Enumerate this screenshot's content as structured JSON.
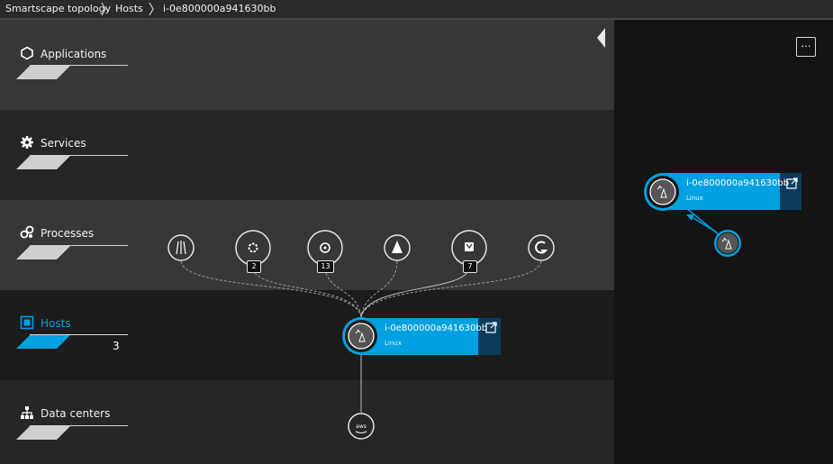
{
  "breadcrumb": {
    "items": [
      "Smartscape topology",
      "Hosts",
      "i-0e800000a941630bb"
    ]
  },
  "layers": [
    {
      "label": "Applications",
      "icon": "hexagon-icon"
    },
    {
      "label": "Services",
      "icon": "gear-icon"
    },
    {
      "label": "Processes",
      "icon": "processes-icon"
    },
    {
      "label": "Hosts",
      "icon": "host-icon",
      "count": "3",
      "active": true
    },
    {
      "label": "Data centers",
      "icon": "datacenter-icon"
    }
  ],
  "processes": [
    {
      "icon": "linux-process-icon",
      "badge": ""
    },
    {
      "icon": "settings-process-icon",
      "badge": "2"
    },
    {
      "icon": "kubernetes-icon",
      "badge": "13"
    },
    {
      "icon": "sail-process-icon",
      "badge": ""
    },
    {
      "icon": "container-process-icon",
      "badge": "7"
    },
    {
      "icon": "go-process-icon",
      "badge": ""
    }
  ],
  "host_node": {
    "name": "i-0e800000a941630bb",
    "os": "Linux",
    "icon": "host-os-icon"
  },
  "panel_node": {
    "name": "i-0e800000a941630bb",
    "os": "Linux"
  },
  "datacenter_node": {
    "label": "aws",
    "icon": "aws-icon"
  },
  "more_button": {
    "label": "…"
  },
  "colors": {
    "accent": "#00a1e0",
    "dark_blue": "#0d3c5b",
    "bg": "#1f1f1f"
  }
}
